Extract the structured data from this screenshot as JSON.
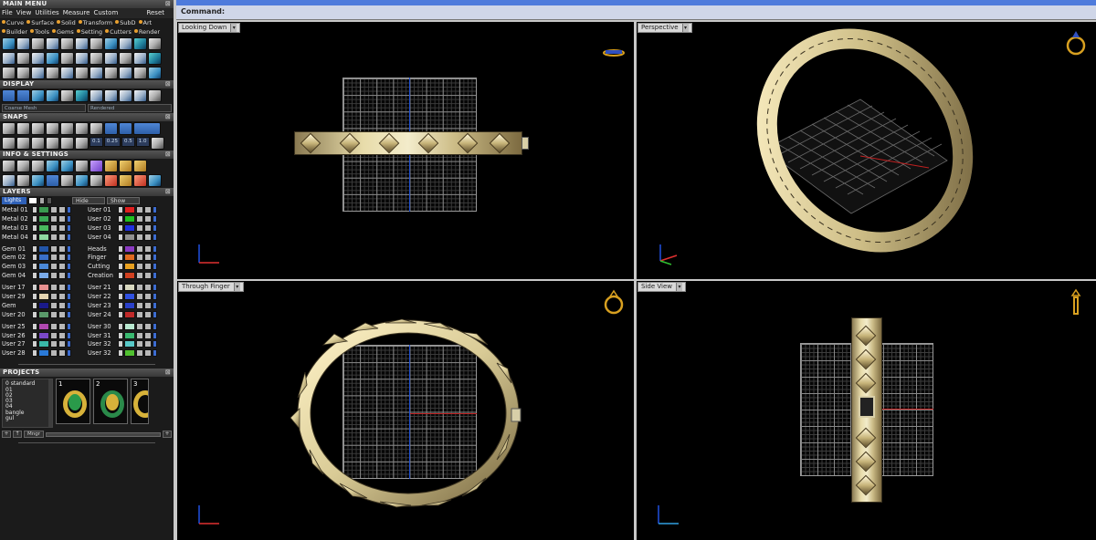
{
  "left_panel": {
    "main_menu": {
      "title": "MAIN MENU",
      "menus": [
        "File",
        "View",
        "Utilities",
        "Measure",
        "Custom"
      ],
      "reset": "Reset",
      "row1": [
        "Curve",
        "Surface",
        "Solid",
        "Transform",
        "SubD",
        "Art"
      ],
      "row2": [
        "Builder",
        "Tools",
        "Gems",
        "Setting",
        "Cutters",
        "Render"
      ]
    },
    "display": {
      "title": "DISPLAY",
      "mesh_select": "Coarse Mesh",
      "render_select": "Rendered"
    },
    "snaps": {
      "title": "SNAPS",
      "values": [
        "0.1",
        "0.25",
        "0.5",
        "1.0"
      ]
    },
    "info": {
      "title": "INFO & SETTINGS"
    },
    "layers": {
      "title": "LAYERS",
      "lights": "Lights",
      "hide": "Hide",
      "show": "Show",
      "left_groups": [
        [
          {
            "name": "Metal 01",
            "color": "#3a9a50"
          },
          {
            "name": "Metal 02",
            "color": "#3aa855"
          },
          {
            "name": "Metal 03",
            "color": "#49b85e"
          },
          {
            "name": "Metal 04",
            "color": "#8fd9a0"
          }
        ],
        [
          {
            "name": "Gem 01",
            "color": "#2255a8"
          },
          {
            "name": "Gem 02",
            "color": "#3a6fc8"
          },
          {
            "name": "Gem 03",
            "color": "#4a88d8"
          },
          {
            "name": "Gem 04",
            "color": "#7aaae8"
          }
        ],
        [
          {
            "name": "User 17",
            "color": "#e89090"
          },
          {
            "name": "User 29",
            "color": "#e4d4b0"
          },
          {
            "name": "Gem",
            "color": "#1a1a8a"
          },
          {
            "name": "User 20",
            "color": "#5a9a6a"
          }
        ],
        [
          {
            "name": "User 25",
            "color": "#b048b0"
          },
          {
            "name": "User 26",
            "color": "#7a48c8"
          },
          {
            "name": "User 27",
            "color": "#3ab8a8"
          },
          {
            "name": "User 28",
            "color": "#2a7ad8"
          }
        ]
      ],
      "right_groups": [
        [
          {
            "name": "User 01",
            "color": "#e02020"
          },
          {
            "name": "User 02",
            "color": "#20c020"
          },
          {
            "name": "User 03",
            "color": "#2030e0"
          },
          {
            "name": "User 04",
            "color": "#909090"
          }
        ],
        [
          {
            "name": "Heads",
            "color": "#8a3ac0"
          },
          {
            "name": "Finger",
            "color": "#e06a20"
          },
          {
            "name": "Cutting",
            "color": "#e8a020"
          },
          {
            "name": "Creation",
            "color": "#d04020"
          }
        ],
        [
          {
            "name": "User 21",
            "color": "#d8d8c0"
          },
          {
            "name": "User 22",
            "color": "#3050e0"
          },
          {
            "name": "User 23",
            "color": "#2a40c8"
          },
          {
            "name": "User 24",
            "color": "#c02a2a"
          }
        ],
        [
          {
            "name": "User 30",
            "color": "#b8e8d0"
          },
          {
            "name": "User 31",
            "color": "#3ab870"
          },
          {
            "name": "User 32",
            "color": "#58c8c8"
          },
          {
            "name": "User 32",
            "color": "#50c030"
          }
        ]
      ]
    },
    "projects": {
      "title": "PROJECTS",
      "items": [
        "0 standard",
        "01",
        "02",
        "03",
        "04",
        "bangle",
        "gul"
      ],
      "thumb_numbers": [
        "1",
        "2",
        "3"
      ],
      "mngr_label": "Mngr"
    }
  },
  "command": {
    "label": "Command:"
  },
  "viewports": {
    "top_left": {
      "title": "Looking Down"
    },
    "top_right": {
      "title": "Perspective"
    },
    "bottom_left": {
      "title": "Through Finger"
    },
    "bottom_right": {
      "title": "Side View"
    }
  },
  "colors": {
    "viewport_bg": "#000000",
    "metal_gold": "#e3d7a6",
    "command_bar": "#cfd6e8",
    "panel_bg": "#1b1b1b"
  }
}
